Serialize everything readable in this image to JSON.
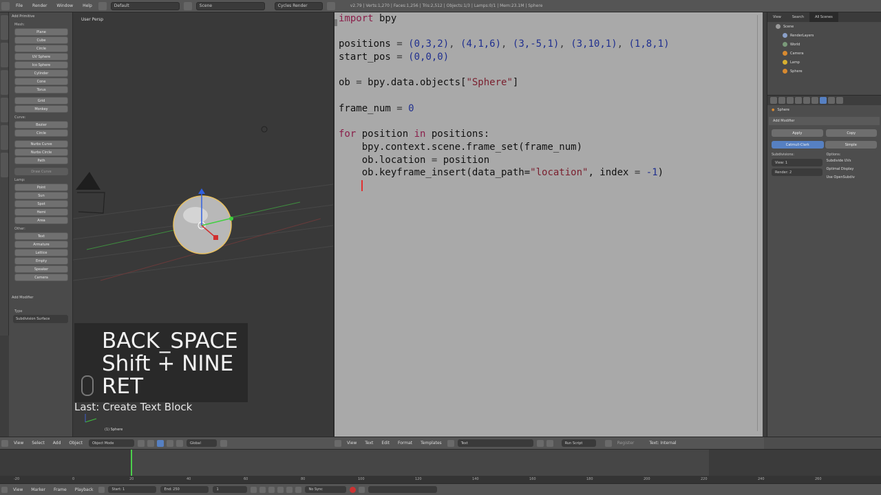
{
  "topbar": {
    "menus": [
      "File",
      "Render",
      "Window",
      "Help"
    ],
    "layout_field": "Default",
    "scene_field": "Scene",
    "engine_field": "Cycles Render",
    "info": "v2.79 | Verts:1,270 | Faces:1,256 | Tris:2,512 | Objects:1/3 | Lamps:0/1 | Mem:23.1M | Sphere"
  },
  "toolshelf": {
    "title": "Add Primitive",
    "groups": [
      {
        "label": "Mesh:",
        "items": [
          "Plane",
          "Cube",
          "Circle",
          "UV Sphere",
          "Ico Sphere",
          "Cylinder",
          "Cone",
          "Torus",
          "Grid",
          "Monkey"
        ]
      },
      {
        "label": "Curve:",
        "items": [
          "Bezier",
          "Circle",
          "Nurbs Curve",
          "Nurbs Circle",
          "Path",
          "Draw Curve"
        ]
      },
      {
        "label": "Lamp:",
        "items": [
          "Point",
          "Sun",
          "Spot",
          "Hemi",
          "Area"
        ]
      },
      {
        "label": "Other:",
        "items": [
          "Text",
          "Armature",
          "Lattice",
          "Empty",
          "Speaker",
          "Camera"
        ]
      }
    ],
    "operator_title": "Add Modifier",
    "operator_field_label": "Type",
    "operator_field_value": "Subdivision Surface"
  },
  "viewport": {
    "label": "User Persp",
    "object_label": "(1) Sphere",
    "key_lines": [
      "BACK_SPACE",
      "Shift + NINE",
      "RET"
    ],
    "last_operator": "Last: Create Text Block"
  },
  "editor": {
    "lines": [
      [
        {
          "t": "import",
          "c": "kw"
        },
        {
          "t": " bpy",
          "c": ""
        }
      ],
      [],
      [
        {
          "t": "positions",
          "c": ""
        },
        {
          "t": " = ",
          "c": "op"
        },
        {
          "t": "(0,3,2)",
          "c": "num"
        },
        {
          "t": ", ",
          "c": "op"
        },
        {
          "t": "(4,1,6)",
          "c": "num"
        },
        {
          "t": ", ",
          "c": "op"
        },
        {
          "t": "(3,-5,1)",
          "c": "num"
        },
        {
          "t": ", ",
          "c": "op"
        },
        {
          "t": "(3,10,1)",
          "c": "num"
        },
        {
          "t": ", ",
          "c": "op"
        },
        {
          "t": "(1,8,1)",
          "c": "num"
        }
      ],
      [
        {
          "t": "start_pos",
          "c": ""
        },
        {
          "t": " = ",
          "c": "op"
        },
        {
          "t": "(0,0,0)",
          "c": "num"
        }
      ],
      [],
      [
        {
          "t": "ob",
          "c": ""
        },
        {
          "t": " = ",
          "c": "op"
        },
        {
          "t": "bpy.data.objects[",
          "c": ""
        },
        {
          "t": "\"Sphere\"",
          "c": "str"
        },
        {
          "t": "]",
          "c": ""
        }
      ],
      [],
      [
        {
          "t": "frame_num",
          "c": ""
        },
        {
          "t": " = ",
          "c": "op"
        },
        {
          "t": "0",
          "c": "num"
        }
      ],
      [],
      [
        {
          "t": "for",
          "c": "kw"
        },
        {
          "t": " position ",
          "c": ""
        },
        {
          "t": "in",
          "c": "kw"
        },
        {
          "t": " positions:",
          "c": ""
        }
      ],
      [
        {
          "t": "    bpy.context.scene.frame_set(frame_num)",
          "c": ""
        }
      ],
      [
        {
          "t": "    ob.location",
          "c": ""
        },
        {
          "t": " = ",
          "c": "op"
        },
        {
          "t": "position",
          "c": ""
        }
      ],
      [
        {
          "t": "    ob.keyframe_insert(data_path=",
          "c": ""
        },
        {
          "t": "\"location\"",
          "c": "str"
        },
        {
          "t": ", index",
          "c": ""
        },
        {
          "t": " = ",
          "c": "op"
        },
        {
          "t": "-1",
          "c": "num"
        },
        {
          "t": ")",
          "c": ""
        }
      ]
    ]
  },
  "outliner": {
    "tabs": [
      "View",
      "Search",
      "All Scenes"
    ],
    "items": [
      {
        "label": "Scene",
        "color": "#9a9a9a"
      },
      {
        "label": "RenderLayers",
        "color": "#8aa0c8"
      },
      {
        "label": "World",
        "color": "#7a9a7a"
      },
      {
        "label": "Camera",
        "color": "#d88a30"
      },
      {
        "label": "Lamp",
        "color": "#d8b030"
      },
      {
        "label": "Sphere",
        "color": "#d88a30"
      }
    ]
  },
  "properties": {
    "object_name": "Sphere",
    "panel_title": "Add Modifier",
    "buttons": [
      "Apply",
      "Copy"
    ],
    "mode_buttons": [
      "Catmull-Clark",
      "Simple"
    ],
    "subdivisions_label": "Subdivisions:",
    "view_field": "View: 1",
    "render_field": "Render: 2",
    "options_label": "Options:",
    "options": [
      "Subdivide UVs",
      "Optimal Display",
      "Use OpenSubdiv"
    ]
  },
  "view3d_header": {
    "menus": [
      "View",
      "Select",
      "Add",
      "Object"
    ],
    "mode_field": "Object Mode",
    "pivot_field": "Global"
  },
  "editor_header": {
    "menus": [
      "View",
      "Text",
      "Edit",
      "Format",
      "Templates"
    ],
    "text_field": "Text",
    "run_button": "Run Script",
    "registered": "Register",
    "status": "Text: Internal"
  },
  "timeline": {
    "ticks": [
      "-20",
      "0",
      "20",
      "40",
      "60",
      "80",
      "100",
      "120",
      "140",
      "160",
      "180",
      "200",
      "220",
      "240",
      "260"
    ],
    "menus": [
      "View",
      "Marker",
      "Frame",
      "Playback"
    ],
    "start_field": "Start: 1",
    "end_field": "End: 250",
    "frame_field": "1",
    "sync_field": "No Sync"
  }
}
